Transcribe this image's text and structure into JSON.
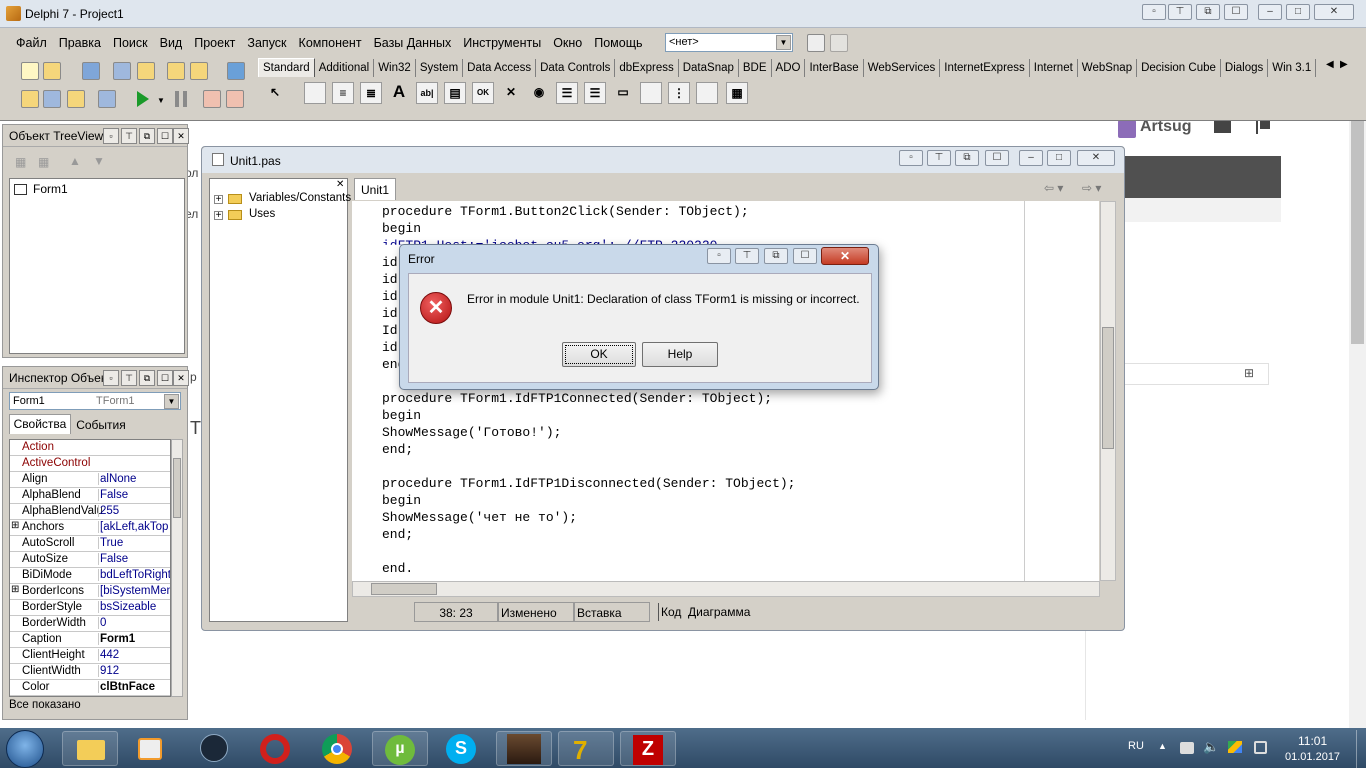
{
  "app": {
    "title": "Delphi 7 - Project1"
  },
  "menu": [
    "Файл",
    "Правка",
    "Поиск",
    "Вид",
    "Проект",
    "Запуск",
    "Компонент",
    "Базы Данных",
    "Инструменты",
    "Окно",
    "Помощь"
  ],
  "toolbar": {
    "config_combo": "<нет>"
  },
  "palette": {
    "tabs": [
      "Standard",
      "Additional",
      "Win32",
      "System",
      "Data Access",
      "Data Controls",
      "dbExpress",
      "DataSnap",
      "BDE",
      "ADO",
      "InterBase",
      "WebServices",
      "InternetExpress",
      "Internet",
      "WebSnap",
      "Decision Cube",
      "Dialogs",
      "Win 3.1"
    ],
    "icons": [
      "cursor-icon",
      "frames-icon",
      "mainmenu-icon",
      "popupmenu-icon",
      "label-icon",
      "edit-icon",
      "memo-icon",
      "button-icon",
      "checkbox-icon",
      "radiobutton-icon",
      "listbox-icon",
      "combobox-icon",
      "scrollbar-icon",
      "groupbox-icon",
      "radiogroup-icon",
      "panel-icon",
      "actionlist-icon"
    ],
    "glyphs": [
      "A",
      "ab|",
      "OK",
      "✕",
      "◉"
    ]
  },
  "treeview": {
    "title": "Объект TreeView",
    "items": [
      "Form1"
    ]
  },
  "inspector": {
    "title": "Инспектор Объекта",
    "object": "Form1",
    "object_type": "TForm1",
    "tabs": [
      "Свойства",
      "События"
    ],
    "rows": [
      {
        "k": "Action",
        "v": ""
      },
      {
        "k": "ActiveControl",
        "v": ""
      },
      {
        "k": "Align",
        "v": "alNone"
      },
      {
        "k": "AlphaBlend",
        "v": "False"
      },
      {
        "k": "AlphaBlendValu",
        "v": "255"
      },
      {
        "k": "Anchors",
        "v": "[akLeft,akTop"
      },
      {
        "k": "AutoScroll",
        "v": "True"
      },
      {
        "k": "AutoSize",
        "v": "False"
      },
      {
        "k": "BiDiMode",
        "v": "bdLeftToRight"
      },
      {
        "k": "BorderIcons",
        "v": "[biSystemMen"
      },
      {
        "k": "BorderStyle",
        "v": "bsSizeable"
      },
      {
        "k": "BorderWidth",
        "v": "0"
      },
      {
        "k": "Caption",
        "v": "Form1"
      },
      {
        "k": "ClientHeight",
        "v": "442"
      },
      {
        "k": "ClientWidth",
        "v": "912"
      },
      {
        "k": "Color",
        "v": "clBtnFace"
      }
    ],
    "status": "Все показано"
  },
  "editor": {
    "title": "Unit1.pas",
    "tab": "Unit1",
    "explorer": [
      "Variables/Constants",
      "Uses"
    ],
    "status": {
      "pos": "38: 23",
      "modified": "Изменено",
      "mode": "Вставка"
    },
    "bottom_tabs": [
      "Код",
      "Диаграмма"
    ],
    "code": [
      "procedure TForm1.Button2Click(Sender: TObject);",
      "begin",
      "idFTP1.Host:='icebot.cu5.org'; //FTP 220220",
      "id",
      "id",
      "id",
      "id",
      "Id",
      "id",
      "end;",
      "",
      "procedure TForm1.IdFTP1Connected(Sender: TObject);",
      "begin",
      "ShowMessage('Готово!');",
      "end;",
      "",
      "procedure TForm1.IdFTP1Disconnected(Sender: TObject);",
      "begin",
      "ShowMessage('чет не то');",
      "end;",
      "",
      "end."
    ]
  },
  "dialog": {
    "title": "Error",
    "message": "Error in module Unit1: Declaration of class TForm1 is missing or incorrect.",
    "ok": "OK",
    "help": "Help"
  },
  "browser_bg": {
    "user": "Artsug",
    "frag1": "ол",
    "frag2": "ел",
    "frag3": "р",
    "frag4": "Т"
  },
  "taskbar": {
    "apps": [
      "explorer-icon",
      "media-player-icon",
      "steam-icon",
      "opera-icon",
      "chrome-icon",
      "utorrent-icon",
      "skype-icon",
      "game-icon",
      "delphi-icon",
      "filezilla-icon"
    ],
    "lang": "RU",
    "time": "11:01",
    "date": "01.01.2017"
  },
  "colors": {
    "accent": "#dfe6ee",
    "error": "#c62828",
    "panel": "#d4d0c8",
    "taskbar": "#2f4a66"
  }
}
